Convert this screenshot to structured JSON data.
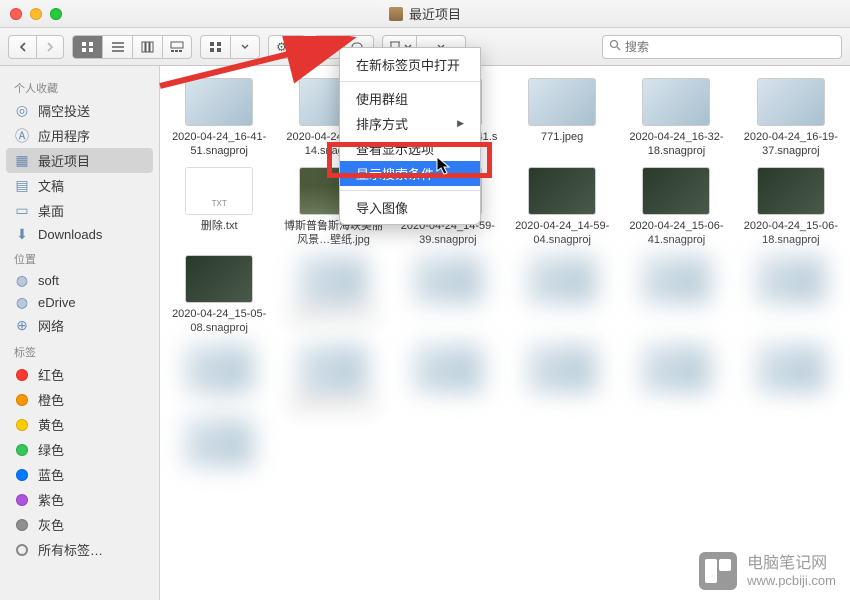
{
  "window": {
    "title": "最近项目"
  },
  "toolbar": {
    "search_placeholder": "搜索"
  },
  "sidebar": {
    "favorites_header": "个人收藏",
    "favorites": [
      {
        "icon": "airdrop",
        "label": "隔空投送"
      },
      {
        "icon": "apps",
        "label": "应用程序"
      },
      {
        "icon": "recents",
        "label": "最近项目",
        "selected": true
      },
      {
        "icon": "docs",
        "label": "文稿"
      },
      {
        "icon": "desktop",
        "label": "桌面"
      },
      {
        "icon": "downloads",
        "label": "Downloads"
      }
    ],
    "locations_header": "位置",
    "locations": [
      {
        "icon": "disk",
        "label": "soft"
      },
      {
        "icon": "disk",
        "label": "eDrive"
      },
      {
        "icon": "network",
        "label": "网络"
      }
    ],
    "tags_header": "标签",
    "tags": [
      {
        "color": "#ff3b30",
        "label": "红色"
      },
      {
        "color": "#ff9500",
        "label": "橙色"
      },
      {
        "color": "#ffcc00",
        "label": "黄色"
      },
      {
        "color": "#34c759",
        "label": "绿色"
      },
      {
        "color": "#007aff",
        "label": "蓝色"
      },
      {
        "color": "#af52de",
        "label": "紫色"
      },
      {
        "color": "#8e8e93",
        "label": "灰色"
      }
    ],
    "all_tags": "所有标签…"
  },
  "dropdown": {
    "items": [
      {
        "label": "在新标签页中打开"
      },
      {
        "sep": true
      },
      {
        "label": "使用群组"
      },
      {
        "label": "排序方式",
        "submenu": true
      },
      {
        "label": "查看显示选项"
      },
      {
        "label": "显示搜索条件",
        "highlight": true
      },
      {
        "sep": true
      },
      {
        "label": "导入图像"
      }
    ]
  },
  "files": [
    {
      "name": "2020-04-24_16-41-51.snagproj",
      "thumb": "app"
    },
    {
      "name": "2020-04-24_16-41-14.snagproj",
      "thumb": "app"
    },
    {
      "name": "2020-04-24_16-41.snagproj",
      "thumb": "app"
    },
    {
      "name": "771.jpeg",
      "thumb": "doc"
    },
    {
      "name": "2020-04-24_16-32-18.snagproj",
      "thumb": "app"
    },
    {
      "name": "2020-04-24_16-19-37.snagproj",
      "thumb": "app"
    },
    {
      "name": "删除.txt",
      "thumb": "txt"
    },
    {
      "name": "博斯普鲁斯海峡美丽风景…壁纸.jpg",
      "thumb": "photo"
    },
    {
      "name": "2020-04-24_14-59-39.snagproj",
      "thumb": "dark"
    },
    {
      "name": "2020-04-24_14-59-04.snagproj",
      "thumb": "dark"
    },
    {
      "name": "2020-04-24_15-06-41.snagproj",
      "thumb": "dark"
    },
    {
      "name": "2020-04-24_15-06-18.snagproj",
      "thumb": "dark"
    },
    {
      "name": "2020-04-24_15-05-08.snagproj",
      "thumb": "dark"
    },
    {
      "name": "2020-04-24_14-4",
      "thumb": "blur"
    },
    {
      "name": "",
      "thumb": "blur"
    },
    {
      "name": "",
      "thumb": "blur"
    },
    {
      "name": "",
      "thumb": "blur"
    },
    {
      "name": "",
      "thumb": "blur"
    },
    {
      "name": "0",
      "thumb": "blur"
    },
    {
      "name": "2020-04-24_11-0",
      "thumb": "blur"
    },
    {
      "name": "",
      "thumb": "blur"
    },
    {
      "name": "",
      "thumb": "blur"
    },
    {
      "name": "",
      "thumb": "blur"
    },
    {
      "name": "",
      "thumb": "blur"
    },
    {
      "name": "",
      "thumb": "blur"
    }
  ],
  "watermark": {
    "name": "电脑笔记网",
    "url": "www.pcbiji.com"
  }
}
